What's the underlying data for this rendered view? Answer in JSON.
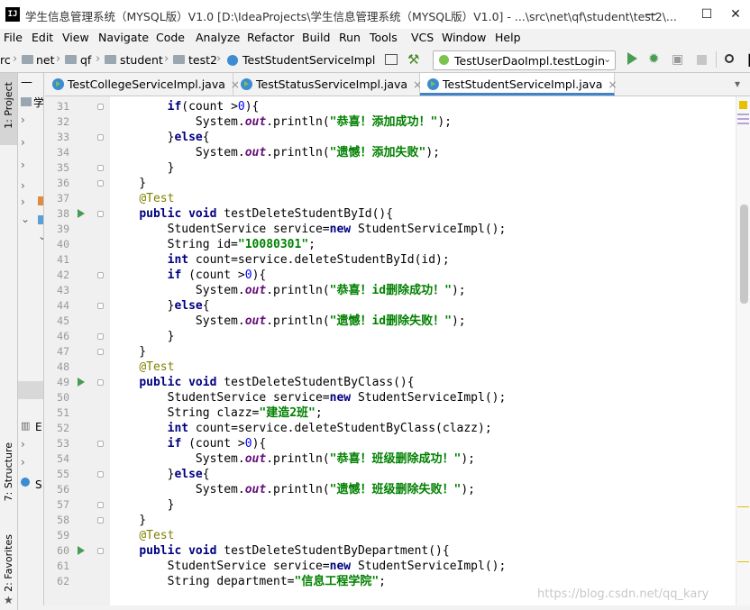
{
  "window": {
    "title": "学生信息管理系统（MYSQL版）V1.0 [D:\\IdeaProjects\\学生信息管理系统（MYSQL版）V1.0] - ...\\src\\net\\qf\\student\\test2\\...",
    "app_icon_text": "IJ",
    "minimize": "—",
    "maximize": "☐",
    "close": "✕"
  },
  "menu": [
    "File",
    "Edit",
    "View",
    "Navigate",
    "Code",
    "Analyze",
    "Refactor",
    "Build",
    "Run",
    "Tools",
    "VCS",
    "Window",
    "Help"
  ],
  "breadcrumbs": [
    "rc",
    "net",
    "qf",
    "student",
    "test2",
    "TestStudentServiceImpl"
  ],
  "run_config": "TestUserDaoImpl.testLogin",
  "tool_windows": {
    "project": "1: Project",
    "structure": "7: Structure",
    "favorites": "2: Favorites"
  },
  "project_pane": {
    "top_label": "学",
    "label_e": "E",
    "label_s": "S"
  },
  "tabs": [
    {
      "label": "TestCollegeServiceImpl.java",
      "active": false
    },
    {
      "label": "TestStatusServiceImpl.java",
      "active": false
    },
    {
      "label": "TestStudentServiceImpl.java",
      "active": true
    }
  ],
  "tab_close": "×",
  "code_lines": [
    {
      "n": "31",
      "t": "        if(count >0){"
    },
    {
      "n": "32",
      "t": "            System.out.println(\"恭喜！添加成功！\");"
    },
    {
      "n": "33",
      "t": "        }else{"
    },
    {
      "n": "34",
      "t": "            System.out.println(\"遗憾！添加失败\");"
    },
    {
      "n": "35",
      "t": "        }"
    },
    {
      "n": "36",
      "t": "    }"
    },
    {
      "n": "37",
      "t": "    @Test"
    },
    {
      "n": "38",
      "t": "    public void testDeleteStudentById(){"
    },
    {
      "n": "39",
      "t": "        StudentService service=new StudentServiceImpl();"
    },
    {
      "n": "40",
      "t": "        String id=\"10080301\";"
    },
    {
      "n": "41",
      "t": "        int count=service.deleteStudentById(id);"
    },
    {
      "n": "42",
      "t": "        if (count >0){"
    },
    {
      "n": "43",
      "t": "            System.out.println(\"恭喜！id删除成功！\");"
    },
    {
      "n": "44",
      "t": "        }else{"
    },
    {
      "n": "45",
      "t": "            System.out.println(\"遗憾！id删除失败！\");"
    },
    {
      "n": "46",
      "t": "        }"
    },
    {
      "n": "47",
      "t": "    }"
    },
    {
      "n": "48",
      "t": "    @Test"
    },
    {
      "n": "49",
      "t": "    public void testDeleteStudentByClass(){"
    },
    {
      "n": "50",
      "t": "        StudentService service=new StudentServiceImpl();"
    },
    {
      "n": "51",
      "t": "        String clazz=\"建造2班\";"
    },
    {
      "n": "52",
      "t": "        int count=service.deleteStudentByClass(clazz);"
    },
    {
      "n": "53",
      "t": "        if (count >0){"
    },
    {
      "n": "54",
      "t": "            System.out.println(\"恭喜！班级删除成功！\");"
    },
    {
      "n": "55",
      "t": "        }else{"
    },
    {
      "n": "56",
      "t": "            System.out.println(\"遗憾！班级删除失败！\");"
    },
    {
      "n": "57",
      "t": "        }"
    },
    {
      "n": "58",
      "t": "    }"
    },
    {
      "n": "59",
      "t": "    @Test"
    },
    {
      "n": "60",
      "t": "    public void testDeleteStudentByDepartment(){"
    },
    {
      "n": "61",
      "t": "        StudentService service=new StudentServiceImpl();"
    },
    {
      "n": "62",
      "t": "        String department=\"信息工程学院\";"
    }
  ],
  "run_gutter_lines": [
    "38",
    "49",
    "60"
  ],
  "watermark": "https://blog.csdn.net/qq_kary",
  "colors": {
    "keyword": "#000080",
    "string": "#008000",
    "number": "#0000ff",
    "annotation": "#808000",
    "static_field": "#660e7a",
    "active_tab_underline": "#4083c9"
  }
}
